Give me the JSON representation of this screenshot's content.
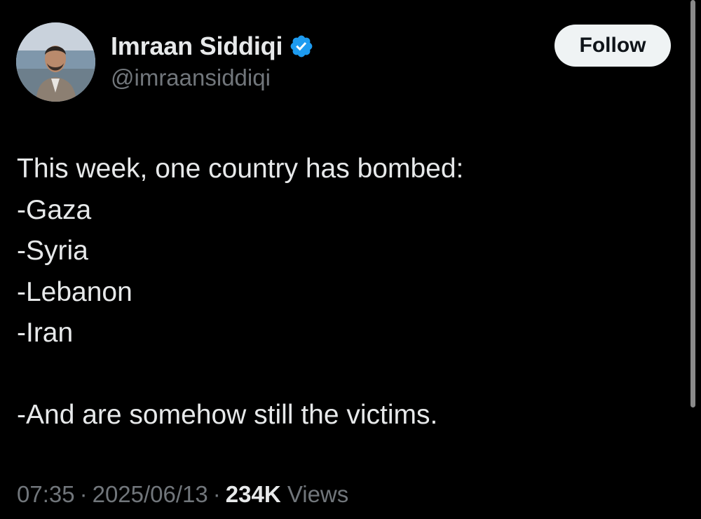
{
  "author": {
    "display_name": "Imraan Siddiqi",
    "handle": "@imraansiddiqi",
    "verified": true,
    "verified_icon": "verified-badge-icon",
    "verified_color": "#1d9bf0"
  },
  "follow_button": {
    "label": "Follow"
  },
  "tweet": {
    "lines": [
      "This week, one country has bombed:",
      "-Gaza",
      "-Syria",
      "-Lebanon",
      "-Iran",
      "",
      "-And are somehow still the victims."
    ]
  },
  "meta": {
    "time": "07:35",
    "separator": "·",
    "date": "2025/06/13",
    "views_count": "234K",
    "views_label": "Views"
  },
  "colors": {
    "background": "#000000",
    "primary_text": "#e7e9ea",
    "secondary_text": "#71767b",
    "button_bg": "#eff3f4"
  }
}
